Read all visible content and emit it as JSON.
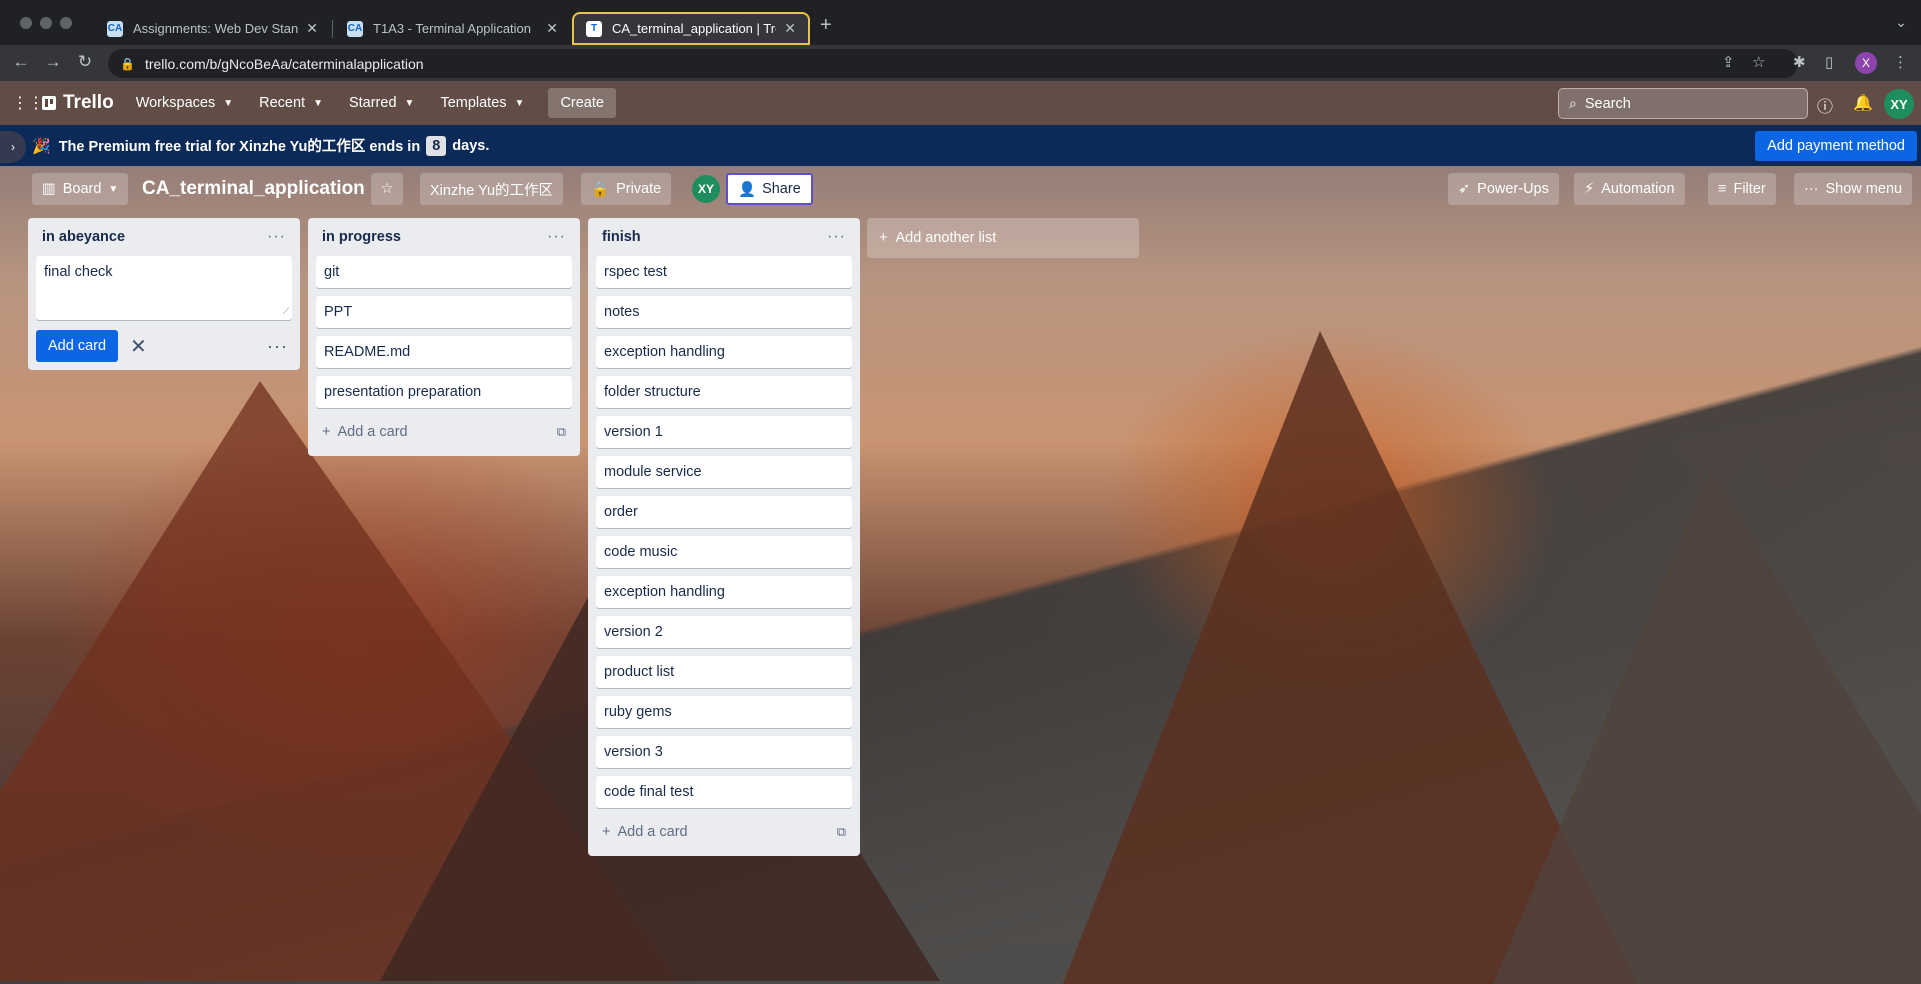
{
  "browser": {
    "tabs": [
      {
        "title": "Assignments: Web Dev Standar",
        "favicon": "CA"
      },
      {
        "title": "T1A3 - Terminal Application",
        "favicon": "CA"
      },
      {
        "title": "CA_terminal_application | Trello",
        "favicon": "T",
        "active": true
      }
    ],
    "url": "trello.com/b/gNcoBeAa/caterminalapplication",
    "profile_initial": "X"
  },
  "header": {
    "logo": "Trello",
    "menu": [
      "Workspaces",
      "Recent",
      "Starred",
      "Templates"
    ],
    "create_label": "Create",
    "search_placeholder": "Search",
    "avatar_initials": "XY"
  },
  "banner": {
    "text_before": "The Premium free trial for Xinzhe Yu的工作区 ends in",
    "days": "8",
    "text_after": "days.",
    "payment_button": "Add payment method"
  },
  "board": {
    "view_label": "Board",
    "title": "CA_terminal_application",
    "workspace": "Xinzhe Yu的工作区",
    "visibility": "Private",
    "member_initials": "XY",
    "share_label": "Share",
    "powerups_label": "Power-Ups",
    "automation_label": "Automation",
    "filter_label": "Filter",
    "show_menu_label": "Show menu"
  },
  "lists": [
    {
      "title": "in abeyance",
      "composer_text": "final check",
      "add_card_button": "Add card",
      "cards": []
    },
    {
      "title": "in progress",
      "add_card_label": "Add a card",
      "cards": [
        "git",
        "PPT",
        "README.md",
        "presentation preparation"
      ]
    },
    {
      "title": "finish",
      "add_card_label": "Add a card",
      "cards": [
        "rspec test",
        "notes",
        "exception handling",
        "folder structure",
        "version 1",
        "module service",
        "order",
        "code music",
        "exception handling",
        "version 2",
        "product list",
        "ruby gems",
        "version 3",
        "code final test"
      ]
    }
  ],
  "add_list_label": "Add another list"
}
